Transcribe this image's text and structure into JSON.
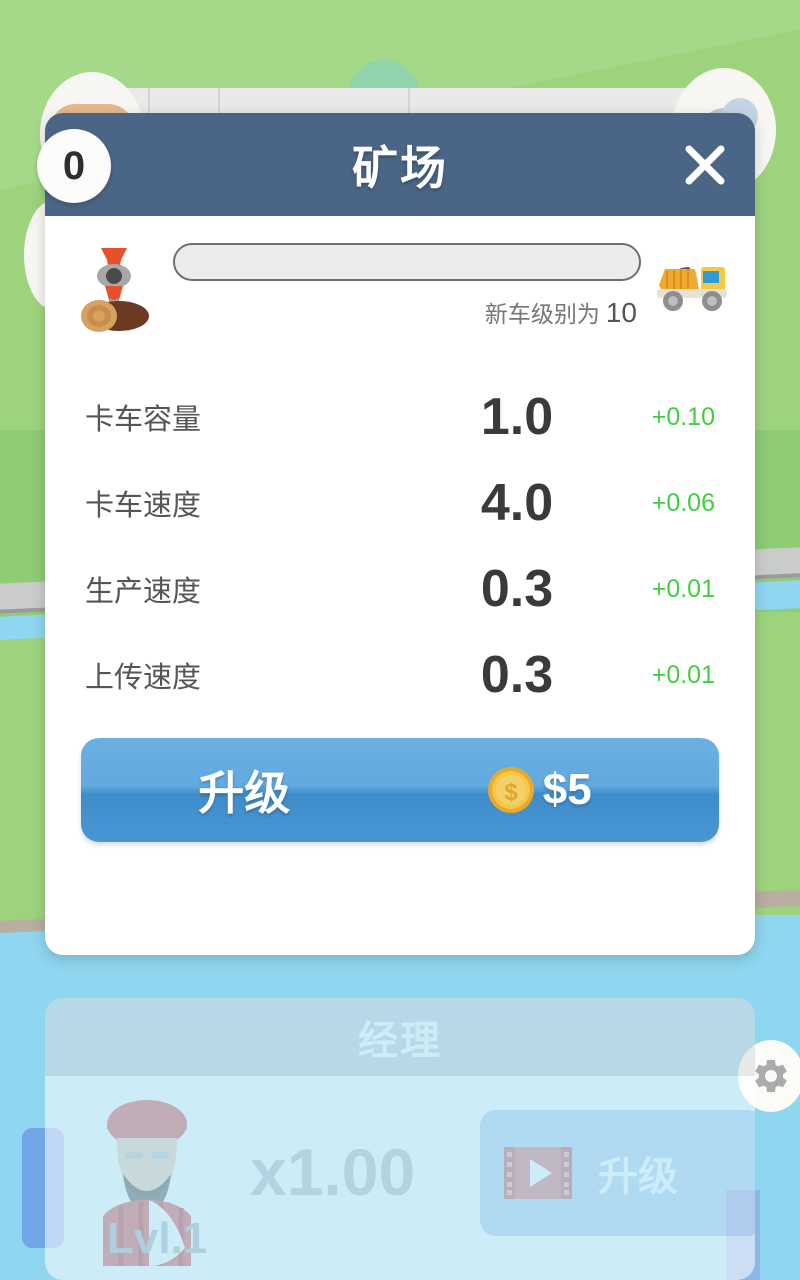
{
  "background": {
    "gear_icon": "gear-icon",
    "colors": {
      "grass": "#9ED37E",
      "water": "#8FD6F0",
      "sky": "#86D4EF",
      "road": "#C9CCCA"
    }
  },
  "modal": {
    "header": {
      "count_badge": "0",
      "title": "矿场",
      "close_icon": "close-icon"
    },
    "progress": {
      "source_icon": "log-grabber-icon",
      "target_icon": "dump-truck-icon",
      "percent": 0,
      "caption_text": "新车级别为",
      "caption_level": "10"
    },
    "stats": [
      {
        "label": "卡车容量",
        "value": "1.0",
        "delta": "+0.10"
      },
      {
        "label": "卡车速度",
        "value": "4.0",
        "delta": "+0.06"
      },
      {
        "label": "生产速度",
        "value": "0.3",
        "delta": "+0.01"
      },
      {
        "label": "上传速度",
        "value": "0.3",
        "delta": "+0.01"
      }
    ],
    "upgrade_button": {
      "label": "升级",
      "coin_icon": "coin-icon",
      "price": "$5"
    },
    "colors": {
      "header_bg": "#4A6585",
      "delta_green": "#3DD13D",
      "button_blue": "#4A96D4"
    }
  },
  "manager_panel": {
    "title": "经理",
    "avatar_icon": "manager-avatar-icon",
    "level": "Lvl.1",
    "multiplier": "x1.00",
    "upgrade_button": {
      "video_icon": "video-ad-icon",
      "label": "升级"
    }
  }
}
